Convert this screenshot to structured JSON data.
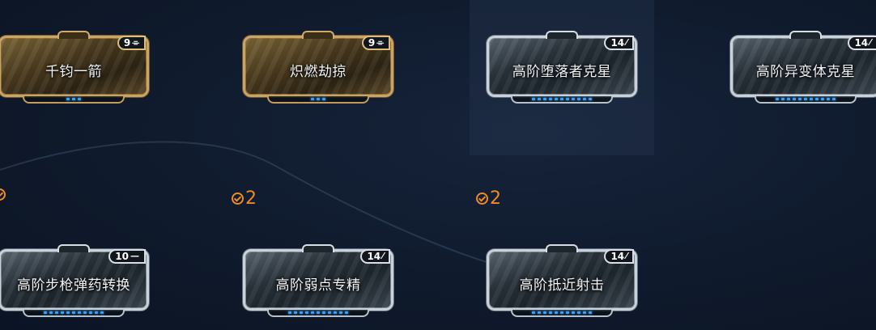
{
  "mods": [
    {
      "name": "千钧一箭",
      "drain": "9",
      "polarity": "madurai",
      "style": "gold",
      "rank_dots": 3
    },
    {
      "name": "炽燃劫掠",
      "drain": "9",
      "polarity": "madurai",
      "style": "gold",
      "rank_dots": 3
    },
    {
      "name": "高阶堕落者克星",
      "drain": "14",
      "polarity": "naramon",
      "style": "silver",
      "rank_dots": 11
    },
    {
      "name": "高阶异变体克星",
      "drain": "14",
      "polarity": "naramon",
      "style": "silver",
      "rank_dots": 11
    },
    {
      "name": "高阶步枪弹药转换",
      "drain": "10",
      "polarity": "vazarin",
      "style": "silver",
      "rank_dots": 11
    },
    {
      "name": "高阶弱点专精",
      "drain": "14",
      "polarity": "naramon",
      "style": "silver",
      "rank_dots": 11
    },
    {
      "name": "高阶抵近射击",
      "drain": "14",
      "polarity": "naramon",
      "style": "silver",
      "rank_dots": 11
    }
  ],
  "badges": [
    {
      "count": ""
    },
    {
      "count": "2"
    },
    {
      "count": "2"
    }
  ],
  "colors": {
    "badge": "#f08a24",
    "rank_dot": "#3aa0ff",
    "gold_frame": "#caa464",
    "silver_frame": "#c9d2da"
  }
}
